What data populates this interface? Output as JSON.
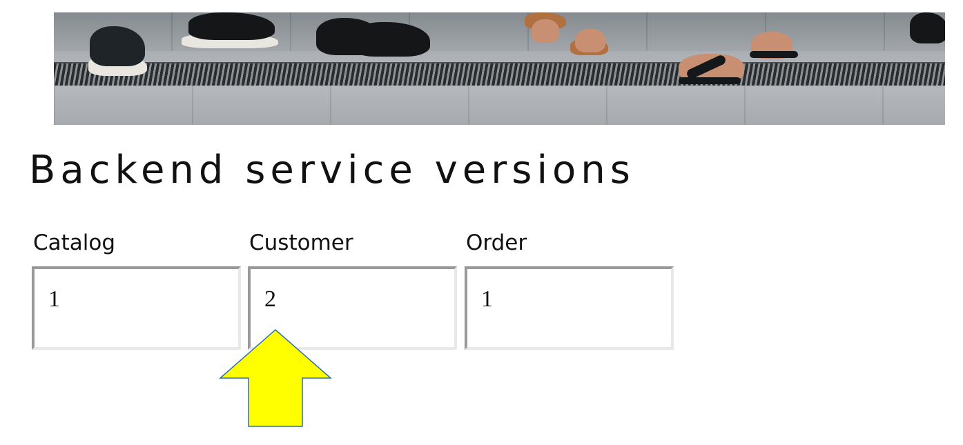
{
  "heading": "Backend service versions",
  "services": [
    {
      "label": "Catalog",
      "value": "1"
    },
    {
      "label": "Customer",
      "value": "2"
    },
    {
      "label": "Order",
      "value": "1"
    }
  ],
  "annotation": {
    "icon": "up-arrow-icon",
    "fill_color": "#ffff00",
    "stroke_color": "#2e6fb5",
    "points_to": "Customer"
  },
  "colors": {
    "field_border_dark": "#999999",
    "field_border_light": "#e8e8e8"
  }
}
